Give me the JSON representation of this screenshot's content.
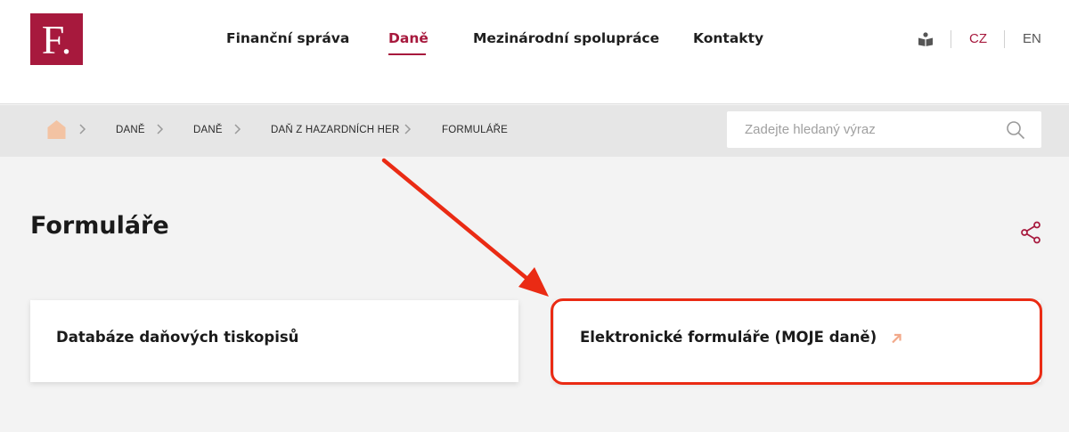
{
  "logo": {
    "letter": "F."
  },
  "nav": {
    "items": [
      {
        "label": "Finanční správa",
        "active": false
      },
      {
        "label": "Daně",
        "active": true
      },
      {
        "label": "Mezinárodní spolupráce",
        "active": false
      },
      {
        "label": "Kontakty",
        "active": false
      }
    ]
  },
  "languages": [
    {
      "label": "CZ",
      "active": true
    },
    {
      "label": "EN",
      "active": false
    }
  ],
  "breadcrumb": {
    "home_icon": "home-icon",
    "items": [
      "DANĚ",
      "DANĚ",
      "DAŇ Z HAZARDNÍCH HER",
      "FORMULÁŘE"
    ]
  },
  "search": {
    "placeholder": "Zadejte hledaný výraz"
  },
  "page": {
    "title": "Formuláře"
  },
  "cards": [
    {
      "label": "Databáze daňových tiskopisů",
      "external": false
    },
    {
      "label": "Elektronické formuláře (MOJE daně)",
      "external": true
    }
  ],
  "colors": {
    "brand": "#a7193d",
    "annotation": "#ea2b14",
    "home_icon": "#f3c3a3",
    "external_icon": "#f2a98a"
  }
}
